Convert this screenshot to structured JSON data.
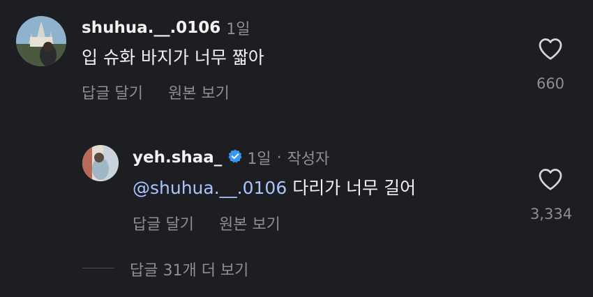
{
  "comment1": {
    "username": "shuhua.__.0106",
    "time": "1일",
    "text": "입 슈화 바지가 너무 짧아",
    "reply_label": "답글 달기",
    "view_original_label": "원본 보기",
    "like_count": "660"
  },
  "reply1": {
    "username": "yeh.shaa_",
    "verified": true,
    "time": "1일",
    "separator": "·",
    "author_tag": "작성자",
    "mention": "@shuhua.__.0106",
    "text": " 다리가 너무 길어",
    "reply_label": "답글 달기",
    "view_original_label": "원본 보기",
    "like_count": "3,334"
  },
  "more_replies_label": "답글 31개 더 보기",
  "colors": {
    "background": "#1d1e22",
    "text_primary": "#f2f2f2",
    "text_secondary": "#8e8e93",
    "mention": "#a9c5ff",
    "verified_badge": "#3897f0"
  },
  "icons": {
    "like": "heart-outline-icon",
    "verified": "verified-badge-icon"
  }
}
